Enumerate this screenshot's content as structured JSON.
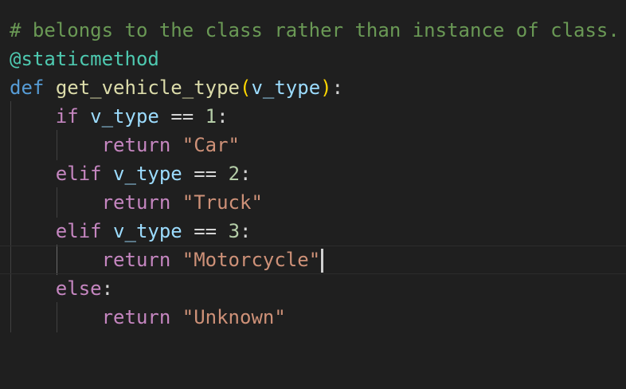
{
  "editor": {
    "indent": "    ",
    "colors": {
      "background": "#1f1f1f",
      "comment": "#6a9955",
      "decorator": "#4ec9b0",
      "keyword": "#569cd6",
      "function": "#dcdcaa",
      "bracket": "#ffd700",
      "parameter": "#9cdcfe",
      "control": "#c586c0",
      "number": "#b5cea8",
      "string": "#ce9178",
      "text": "#d4d4d4"
    },
    "tokens": {
      "comment": "# belongs to the class rather than instance of class.",
      "decorator": "@staticmethod",
      "def_keyword": "def",
      "function_name": "get_vehicle_type",
      "open_paren": "(",
      "param": "v_type",
      "close_paren": ")",
      "colon": ":",
      "if_keyword": "if",
      "elif_keyword": "elif",
      "else_keyword": "else",
      "return_keyword": "return",
      "equals_op": "==",
      "num_1": "1",
      "num_2": "2",
      "num_3": "3",
      "str_car": "\"Car\"",
      "str_truck": "\"Truck\"",
      "str_motorcycle": "\"Motorcycle\"",
      "str_unknown": "\"Unknown\""
    }
  }
}
